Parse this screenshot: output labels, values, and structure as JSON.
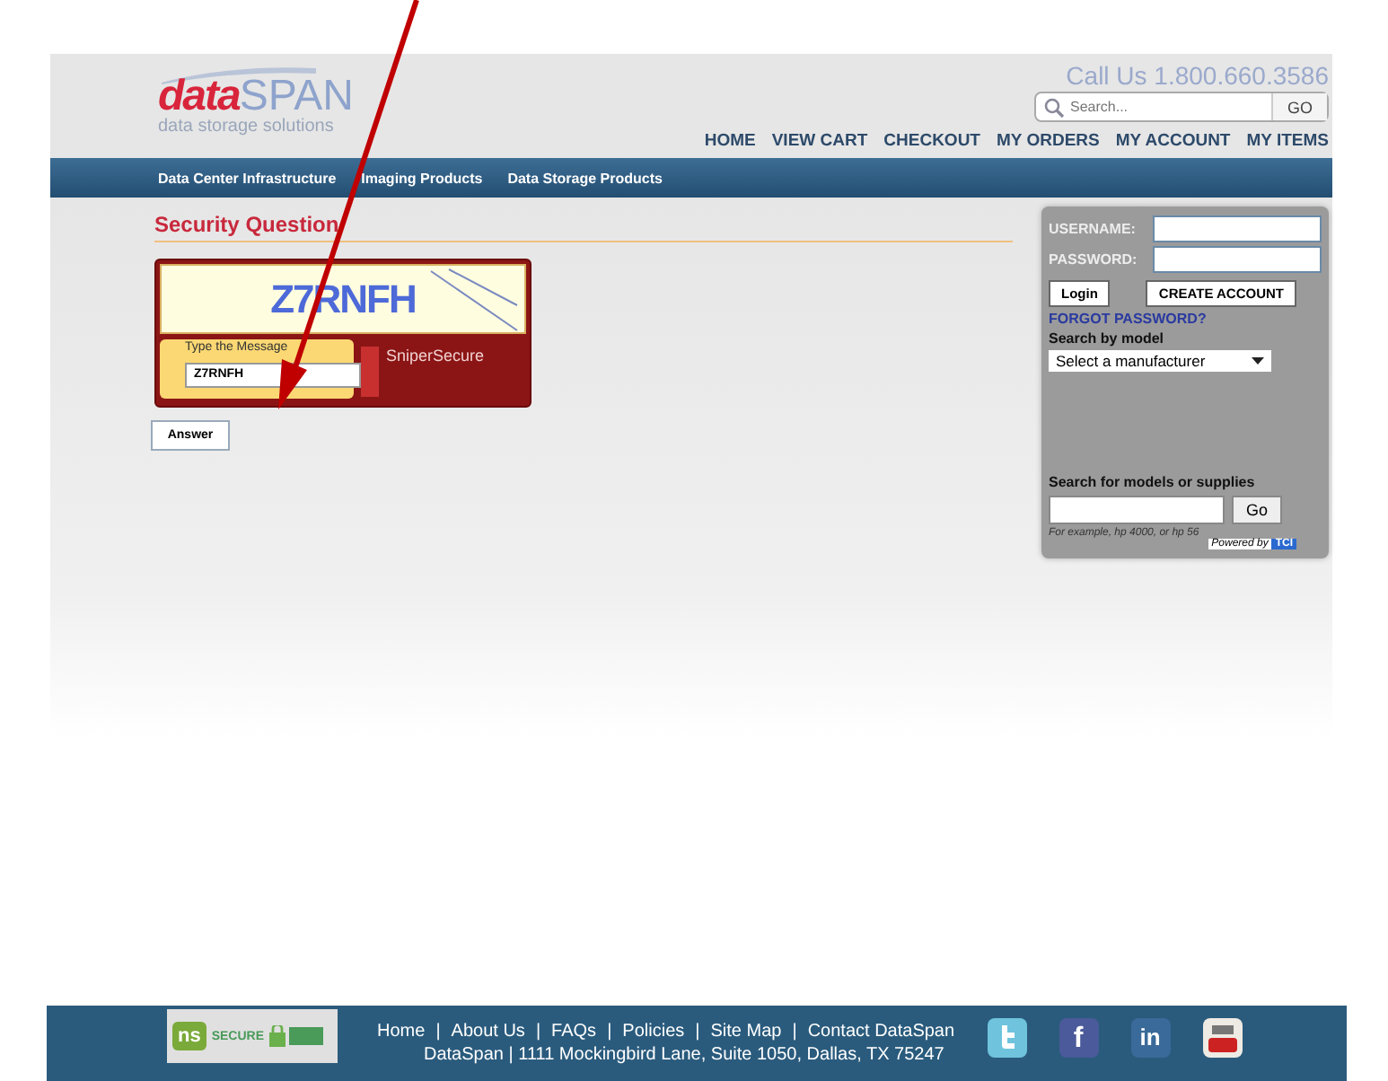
{
  "header": {
    "logo_main": "data",
    "logo_accent": "SPAN",
    "tagline": "data storage solutions",
    "phone": "Call Us 1.800.660.3586",
    "search": {
      "placeholder": "Search...",
      "button": "GO"
    },
    "nav": [
      "HOME",
      "VIEW CART",
      "CHECKOUT",
      "MY ORDERS",
      "MY ACCOUNT",
      "MY ITEMS"
    ]
  },
  "categories": [
    "Data Center Infrastructure",
    "Imaging Products",
    "Data Storage Products"
  ],
  "main": {
    "heading": "Security Question",
    "captcha": {
      "code": "Z7RNFH",
      "prompt": "Type the Message",
      "value": "Z7RNFH",
      "brand": "SniperSecure"
    },
    "button": "Answer"
  },
  "login": {
    "username_label": "USERNAME:",
    "password_label": "PASSWORD:",
    "login_button": "Login",
    "create_button": "CREATE ACCOUNT",
    "forgot": "FORGOT PASSWORD?",
    "model_heading": "Search by model",
    "manufacturer": "Select a manufacturer",
    "supplies_heading": "Search for models or supplies",
    "go_button": "Go",
    "example": "For example, hp 4000, or hp 56",
    "powered": "Powered by",
    "powered_logo": "TCI"
  },
  "footer": {
    "badge": {
      "logo": "ns",
      "text": "SECURE"
    },
    "separator": "|",
    "links": [
      "Home",
      "About Us",
      "FAQs",
      "Policies",
      "Site Map",
      "Contact DataSpan"
    ],
    "address": "DataSpan | 1111 Mockingbird Lane, Suite 1050, Dallas, TX 75247",
    "social": [
      {
        "kind": "twitter"
      },
      {
        "kind": "facebook",
        "label": "f"
      },
      {
        "kind": "linkedin",
        "label": "in"
      },
      {
        "kind": "youtube"
      }
    ]
  }
}
